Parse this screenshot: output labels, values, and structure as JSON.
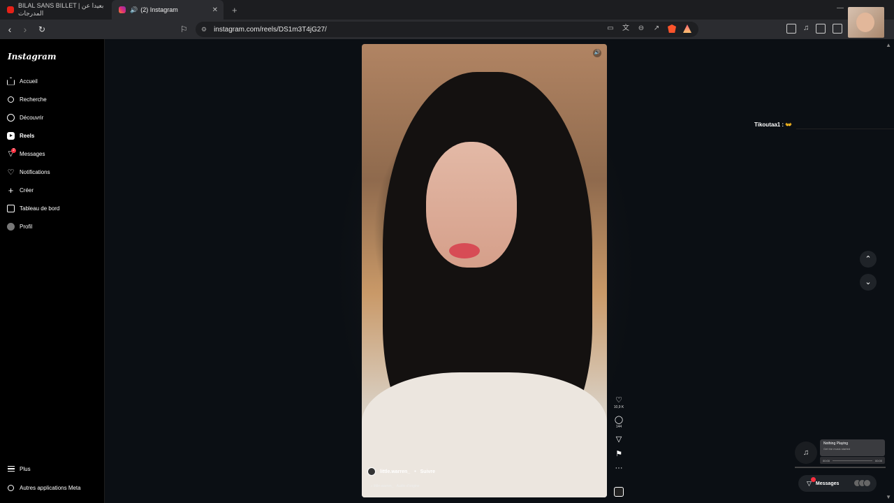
{
  "browser": {
    "tabs": [
      {
        "label": "BILAL SANS BILLET | بعيدا عن المدرجات"
      },
      {
        "label": "(2) Instagram"
      }
    ],
    "url": "instagram.com/reels/DS1m3T4jG27/",
    "rewards_badge": "1"
  },
  "sidebar": {
    "logo": "Instagram",
    "items": [
      {
        "label": "Accueil"
      },
      {
        "label": "Recherche"
      },
      {
        "label": "Découvrir"
      },
      {
        "label": "Reels"
      },
      {
        "label": "Messages",
        "badge": "2"
      },
      {
        "label": "Notifications"
      },
      {
        "label": "Créer"
      },
      {
        "label": "Tableau de bord"
      },
      {
        "label": "Profil"
      }
    ],
    "bottom": [
      {
        "label": "Plus"
      },
      {
        "label": "Autres applications Meta"
      }
    ]
  },
  "reel": {
    "username": "little.warren_",
    "separator": "•",
    "follow": "Suivre",
    "audio": "little.warren_ · Audio d'origine",
    "likes": "10,9 K",
    "comments": "144"
  },
  "overlay_comment": {
    "author": "Tikoutaa1 :",
    "emoji": "👐"
  },
  "music": {
    "title": "Nothing Playing",
    "subtitle": "Get the music started",
    "time_start": "00:00",
    "time_end": "00:00"
  },
  "messages_pill": {
    "label": "Messages",
    "badge": "2"
  }
}
